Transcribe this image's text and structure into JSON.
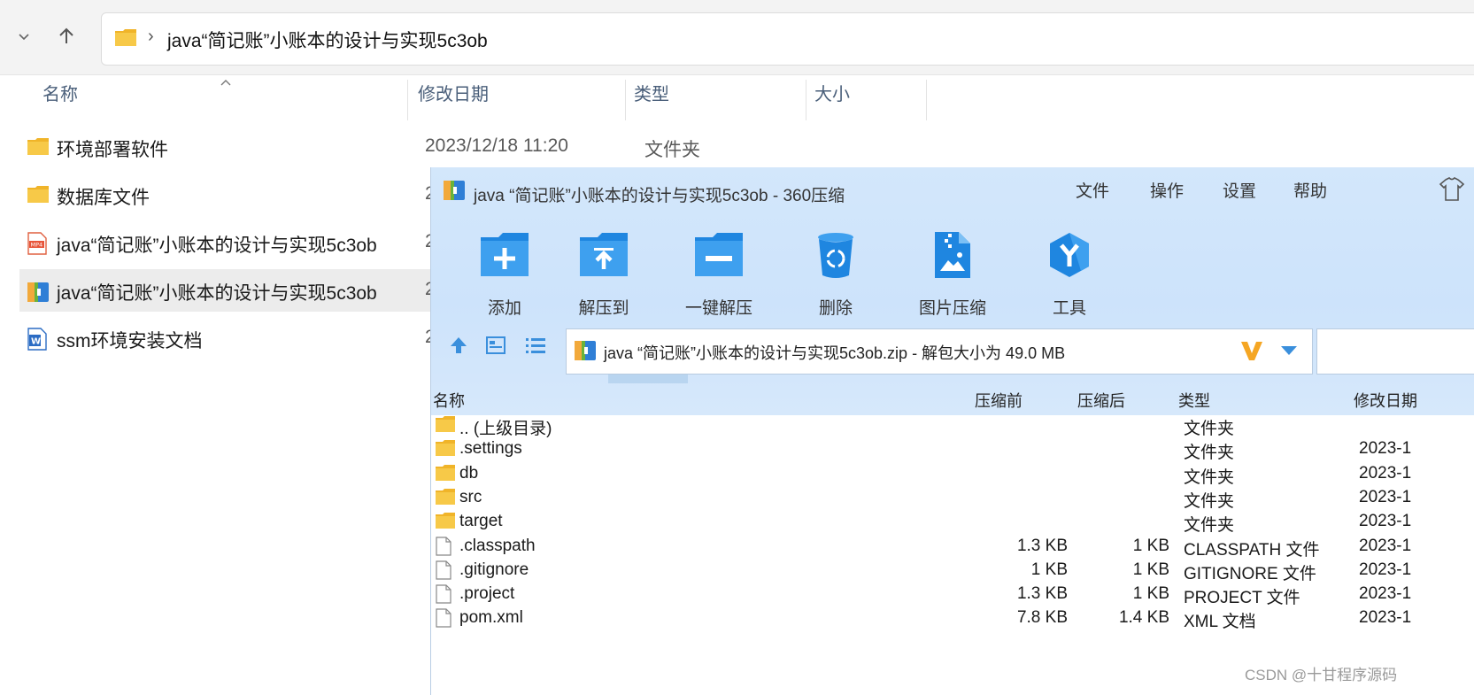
{
  "explorer": {
    "path": "java“简记账”小账本的设计与实现5c3ob",
    "columns": {
      "name": "名称",
      "modified": "修改日期",
      "type": "类型",
      "size": "大小"
    },
    "items": [
      {
        "name": "环境部署软件",
        "date": "2023/12/18 11:20",
        "type": "文件夹",
        "icon": "folder-icon"
      },
      {
        "name": "数据库文件",
        "date": "2",
        "type": "",
        "icon": "folder-icon"
      },
      {
        "name": "java“简记账”小账本的设计与实现5c3ob",
        "date": "2",
        "type": "",
        "icon": "mp4-file-icon"
      },
      {
        "name": "java“简记账”小账本的设计与实现5c3ob",
        "date": "2",
        "type": "",
        "icon": "zip-archive-icon"
      },
      {
        "name": "ssm环境安装文档",
        "date": "2",
        "type": "",
        "icon": "word-doc-icon"
      }
    ]
  },
  "archiver": {
    "title": "java “简记账”小账本的设计与实现5c3ob - 360压缩",
    "menu": [
      "文件",
      "操作",
      "设置",
      "帮助"
    ],
    "tools": [
      "添加",
      "解压到",
      "一键解压",
      "删除",
      "图片压缩",
      "工具"
    ],
    "address": "java “简记账”小账本的设计与实现5c3ob.zip - 解包大小为 49.0 MB",
    "columns": {
      "name": "名称",
      "before": "压缩前",
      "after": "压缩后",
      "type": "类型",
      "modified": "修改日期"
    },
    "rows": [
      {
        "name": ".. (上级目录)",
        "before": "",
        "after": "",
        "type": "文件夹",
        "date": "",
        "kind": "folder"
      },
      {
        "name": ".settings",
        "before": "",
        "after": "",
        "type": "文件夹",
        "date": "2023-1",
        "kind": "folder"
      },
      {
        "name": "db",
        "before": "",
        "after": "",
        "type": "文件夹",
        "date": "2023-1",
        "kind": "folder"
      },
      {
        "name": "src",
        "before": "",
        "after": "",
        "type": "文件夹",
        "date": "2023-1",
        "kind": "folder"
      },
      {
        "name": "target",
        "before": "",
        "after": "",
        "type": "文件夹",
        "date": "2023-1",
        "kind": "folder"
      },
      {
        "name": ".classpath",
        "before": "1.3 KB",
        "after": "1 KB",
        "type": "CLASSPATH 文件",
        "date": "2023-1",
        "kind": "file"
      },
      {
        "name": ".gitignore",
        "before": "1 KB",
        "after": "1 KB",
        "type": "GITIGNORE 文件",
        "date": "2023-1",
        "kind": "file"
      },
      {
        "name": ".project",
        "before": "1.3 KB",
        "after": "1 KB",
        "type": "PROJECT 文件",
        "date": "2023-1",
        "kind": "file"
      },
      {
        "name": "pom.xml",
        "before": "7.8 KB",
        "after": "1.4 KB",
        "type": "XML 文档",
        "date": "2023-1",
        "kind": "file"
      }
    ]
  },
  "watermark": "CSDN @十甘程序源码",
  "colors": {
    "accent_blue": "#1e88e5",
    "folder_yellow": "#f7c948",
    "archiver_bg": "#d3e7fb"
  }
}
